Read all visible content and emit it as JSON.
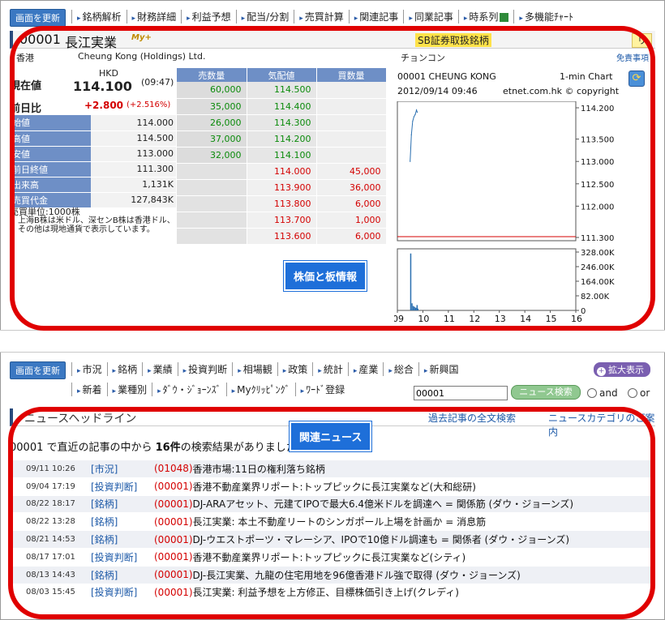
{
  "top": {
    "refresh_label": "画面を更新",
    "nav": [
      "銘柄解析",
      "財務詳細",
      "利益予想",
      "配当/分割",
      "売買計算",
      "関連記事",
      "同業記事",
      "時系列",
      "多機能ﾁｬｰﾄ"
    ]
  },
  "stock": {
    "code": "00001",
    "name": "長江実業",
    "my_badge": "My+",
    "sbi_badge": "SB証券取扱銘柄",
    "ri_badge": "リ",
    "market": "香港",
    "english_name": "Cheung Kong (Holdings) Ltd.",
    "kana_name": "チョンコン",
    "disclaimer": "免責事項"
  },
  "quote": {
    "current_label": "現在値",
    "currency": "HKD",
    "price": "114.100",
    "time": "(09:47)",
    "change_label": "前日比",
    "change": "+2.800",
    "change_pct": "(+2.516%)",
    "rows": [
      {
        "label": "始値",
        "value": "114.000"
      },
      {
        "label": "高値",
        "value": "114.500"
      },
      {
        "label": "安値",
        "value": "113.000"
      },
      {
        "label": "前日終値",
        "value": "111.300"
      },
      {
        "label": "出来高",
        "value": "1,131K"
      },
      {
        "label": "売買代金",
        "value": "127,843K"
      }
    ],
    "unit_line": "売買単位:1000株",
    "note_1": "上海B株は米ドル、深センB株は香港ドル、",
    "note_2": "その他は現地通貨で表示しています。"
  },
  "board": {
    "headers": [
      "売数量",
      "気配値",
      "買数量"
    ],
    "asks": [
      {
        "qty": "60,000",
        "price": "114.500"
      },
      {
        "qty": "35,000",
        "price": "114.400"
      },
      {
        "qty": "26,000",
        "price": "114.300"
      },
      {
        "qty": "37,000",
        "price": "114.200"
      },
      {
        "qty": "32,000",
        "price": "114.100"
      }
    ],
    "bids": [
      {
        "price": "114.000",
        "qty": "45,000"
      },
      {
        "price": "113.900",
        "qty": "36,000"
      },
      {
        "price": "113.800",
        "qty": "6,000"
      },
      {
        "price": "113.700",
        "qty": "1,000"
      },
      {
        "price": "113.600",
        "qty": "6,000"
      }
    ]
  },
  "chart_data": {
    "type": "line",
    "title": "00001 CHEUNG KONG",
    "subtitle": "1-min Chart",
    "date": "2012/09/14 09:46",
    "copyright": "etnet.com.hk © copyright",
    "price_ticks": [
      "114.200",
      "113.500",
      "113.000",
      "112.500",
      "112.000",
      "111.300"
    ],
    "price_ylim": [
      111.3,
      114.2
    ],
    "prev_close": 111.3,
    "price_series": {
      "x": [
        9.5,
        9.55,
        9.6,
        9.65,
        9.7,
        9.75,
        9.78
      ],
      "values": [
        113.0,
        113.6,
        113.9,
        114.0,
        114.05,
        114.15,
        114.1
      ]
    },
    "volume_ticks": [
      "328.00K",
      "246.00K",
      "164.00K",
      "82.00K",
      "0"
    ],
    "volume_ylim": [
      0,
      328000
    ],
    "volume_series": {
      "x": [
        9.5,
        9.55,
        9.6,
        9.65,
        9.7,
        9.75,
        9.78
      ],
      "values": [
        320000,
        40000,
        25000,
        20000,
        15000,
        30000,
        10000
      ]
    },
    "x_ticks": [
      "09",
      "10",
      "11",
      "12",
      "13",
      "14",
      "15",
      "16"
    ],
    "xlim": [
      9,
      16
    ]
  },
  "overlays": {
    "label_stock": "株価と板情報",
    "label_news": "関連ニュース"
  },
  "news_nav": {
    "refresh_label": "画面を更新",
    "row1": [
      "市況",
      "銘柄",
      "業績",
      "投資判断",
      "相場観",
      "政策",
      "統計",
      "産業",
      "総合",
      "新興国"
    ],
    "row2": [
      "新着",
      "業種別",
      "ﾀﾞｳ・ｼﾞｮｰﾝｽﾞ",
      "Myｸﾘｯﾋﾟﾝｸﾞ",
      "ﾜｰﾄﾞ登録"
    ],
    "expand_label": "拡大表示",
    "search_value": "00001",
    "search_button": "ニュース検索",
    "radio_and": "and",
    "radio_or": "or"
  },
  "headlines": {
    "title": "ニュースヘッドライン",
    "link_past": "過去記事の全文検索",
    "link_category": "ニュースカテゴリのご案内",
    "result_prefix": "00001 で直近の記事の中から",
    "result_count": "16件",
    "result_suffix": "の検索結果がありました"
  },
  "news": [
    {
      "date": "09/11 10:26",
      "cat": "[市況]",
      "code": "(01048)",
      "title": "香港市場:11日の権利落ち銘柄"
    },
    {
      "date": "09/04 17:19",
      "cat": "[投資判断]",
      "code": "(00001)",
      "title": "香港不動産業界リポート:トップピックに長江実業など(大和総研)"
    },
    {
      "date": "08/22 18:17",
      "cat": "[銘柄]",
      "code": "(00001)",
      "title": "DJ-ARAアセット、元建てIPOで最大6.4億米ドルを調達へ = 関係筋 (ダウ・ジョーンズ)"
    },
    {
      "date": "08/22 13:28",
      "cat": "[銘柄]",
      "code": "(00001)",
      "title": "長江実業: 本土不動産リートのシンガポール上場を計画か = 消息筋"
    },
    {
      "date": "08/21 14:53",
      "cat": "[銘柄]",
      "code": "(00001)",
      "title": "DJ-ウエストポーツ・マレーシア、IPOで10億ドル調達も = 関係者 (ダウ・ジョーンズ)"
    },
    {
      "date": "08/17 17:01",
      "cat": "[投資判断]",
      "code": "(00001)",
      "title": "香港不動産業界リポート:トップピックに長江実業など(シティ)"
    },
    {
      "date": "08/13 14:43",
      "cat": "[銘柄]",
      "code": "(00001)",
      "title": "DJ-長江実業、九龍の住宅用地を96億香港ドル強で取得 (ダウ・ジョーンズ)"
    },
    {
      "date": "08/03 15:45",
      "cat": "[投資判断]",
      "code": "(00001)",
      "title": "長江実業: 利益予想を上方修正、目標株価引き上げ(クレディ)"
    }
  ]
}
